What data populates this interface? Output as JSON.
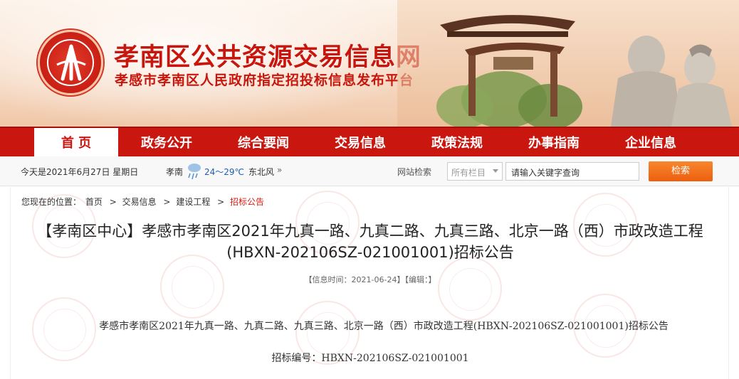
{
  "header": {
    "title": "孝南区公共资源交易信息网",
    "subtitle": "孝感市孝南区人民政府指定招投标信息发布平台"
  },
  "nav": {
    "items": [
      {
        "label": "首 页"
      },
      {
        "label": "政务公开"
      },
      {
        "label": "综合要闻"
      },
      {
        "label": "交易信息"
      },
      {
        "label": "政策法规"
      },
      {
        "label": "办事指南"
      },
      {
        "label": "企业信息"
      }
    ],
    "active_index": 0
  },
  "infobar": {
    "date": "今天是2021年6月27日 星期日",
    "city": "孝南",
    "temperature": "24～29℃",
    "wind": "东北风",
    "more_arrow": "»",
    "search_label": "网站检索",
    "category_select": "所有栏目",
    "search_input_value": "请输入关键字查询",
    "search_button": "检索"
  },
  "breadcrumb": {
    "prefix": "您现在的位置：",
    "items": [
      "首页",
      "交易信息",
      "建设工程",
      "招标公告"
    ],
    "separator": ">"
  },
  "article": {
    "title": "【孝南区中心】孝感市孝南区2021年九真一路、九真二路、九真三路、北京一路（西）市政改造工程(HBXN-202106SZ-021001001)招标公告",
    "meta": "【信息时间：2021-06-24】【编辑：】",
    "body_heading": "孝感市孝南区2021年九真一路、九真二路、九真三路、北京一路（西）市政改造工程(HBXN-202106SZ-021001001)招标公告",
    "bid_number": "招标编号：HBXN-202106SZ-021001001"
  },
  "colors": {
    "brand_red": "#c9160f",
    "accent_orange": "#ee5f0e",
    "current_crumb": "#d81c10"
  }
}
